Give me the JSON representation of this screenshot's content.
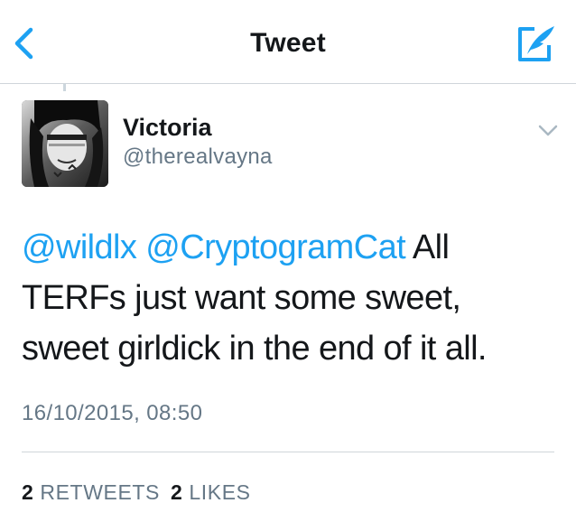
{
  "nav": {
    "title": "Tweet",
    "back_icon": "chevron-left-icon",
    "compose_icon": "compose-tweet-icon",
    "accent_color": "#1da1f2"
  },
  "tweet": {
    "author": {
      "name": "Victoria",
      "handle": "@therealvayna",
      "avatar": "profile-photo"
    },
    "menu_icon": "chevron-down-icon",
    "mentions": [
      "@wildlx",
      "@CryptogramCat"
    ],
    "body_line1_rest": " All",
    "body_line2": "TERFs just want some sweet,",
    "body_line3": "sweet girldick in the end of it all.",
    "timestamp": "16/10/2015, 08:50",
    "stats": {
      "retweets_count": "2",
      "retweets_label": "RETWEETS",
      "likes_count": "2",
      "likes_label": "LIKES"
    }
  }
}
